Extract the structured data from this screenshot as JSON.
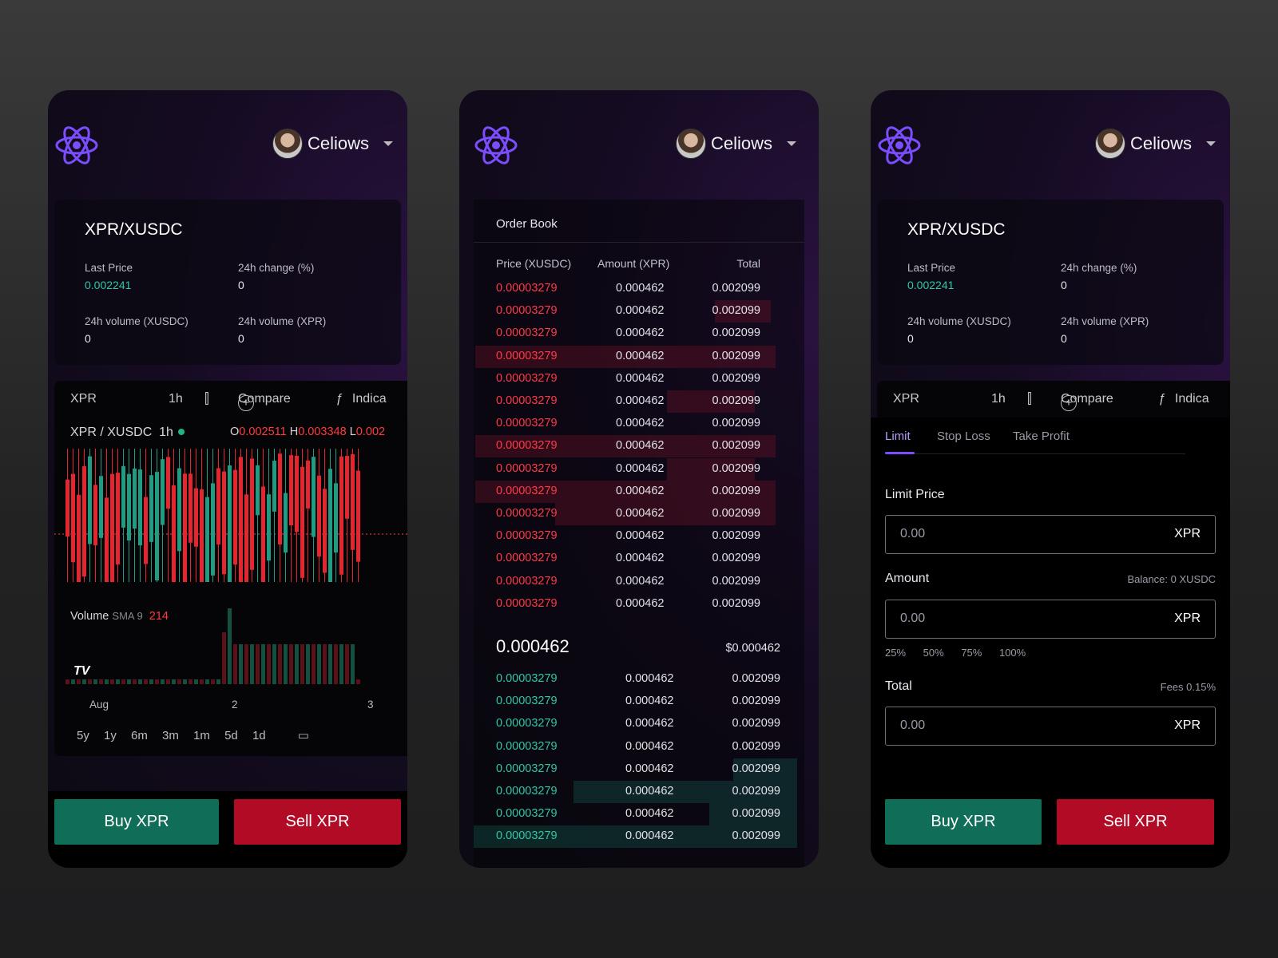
{
  "user": {
    "name": "Celiows"
  },
  "pair": "XPR/XUSDC",
  "stats": {
    "last_price_label": "Last Price",
    "last_price": "0.002241",
    "change_label": "24h change (%)",
    "change": "0",
    "vol_xusdc_label": "24h volume (XUSDC)",
    "vol_xusdc": "0",
    "vol_xpr_label": "24h volume (XPR)",
    "vol_xpr": "0"
  },
  "chart_toolbar": {
    "symbol": "XPR",
    "interval": "1h",
    "compare": "Compare",
    "indicators": "Indica"
  },
  "chart": {
    "title": "XPR / XUSDC",
    "interval": "1h",
    "ohlc_o": "0.002511",
    "ohlc_h": "0.003348",
    "ohlc_l": "0.002",
    "volume_label": "Volume",
    "sma": "SMA 9",
    "volume_value": "214",
    "axis": [
      "Aug",
      "2",
      "3"
    ],
    "ranges": [
      "5y",
      "1y",
      "6m",
      "3m",
      "1m",
      "5d",
      "1d"
    ]
  },
  "buttons": {
    "buy": "Buy XPR",
    "sell": "Sell XPR"
  },
  "orderbook": {
    "title": "Order Book",
    "headers": {
      "price": "Price (XUSDC)",
      "amount": "Amount (XPR)",
      "total": "Total"
    },
    "asks": [
      {
        "price": "0.00003279",
        "amount": "0.000462",
        "total": "0.002099"
      },
      {
        "price": "0.00003279",
        "amount": "0.000462",
        "total": "0.002099"
      },
      {
        "price": "0.00003279",
        "amount": "0.000462",
        "total": "0.002099"
      },
      {
        "price": "0.00003279",
        "amount": "0.000462",
        "total": "0.002099"
      },
      {
        "price": "0.00003279",
        "amount": "0.000462",
        "total": "0.002099"
      },
      {
        "price": "0.00003279",
        "amount": "0.000462",
        "total": "0.002099"
      },
      {
        "price": "0.00003279",
        "amount": "0.000462",
        "total": "0.002099"
      },
      {
        "price": "0.00003279",
        "amount": "0.000462",
        "total": "0.002099"
      },
      {
        "price": "0.00003279",
        "amount": "0.000462",
        "total": "0.002099"
      },
      {
        "price": "0.00003279",
        "amount": "0.000462",
        "total": "0.002099"
      },
      {
        "price": "0.00003279",
        "amount": "0.000462",
        "total": "0.002099"
      },
      {
        "price": "0.00003279",
        "amount": "0.000462",
        "total": "0.002099"
      },
      {
        "price": "0.00003279",
        "amount": "0.000462",
        "total": "0.002099"
      },
      {
        "price": "0.00003279",
        "amount": "0.000462",
        "total": "0.002099"
      },
      {
        "price": "0.00003279",
        "amount": "0.000462",
        "total": "0.002099"
      }
    ],
    "mid_price": "0.000462",
    "mid_usd": "$0.000462",
    "bids": [
      {
        "price": "0.00003279",
        "amount": "0.000462",
        "total": "0.002099"
      },
      {
        "price": "0.00003279",
        "amount": "0.000462",
        "total": "0.002099"
      },
      {
        "price": "0.00003279",
        "amount": "0.000462",
        "total": "0.002099"
      },
      {
        "price": "0.00003279",
        "amount": "0.000462",
        "total": "0.002099"
      },
      {
        "price": "0.00003279",
        "amount": "0.000462",
        "total": "0.002099"
      },
      {
        "price": "0.00003279",
        "amount": "0.000462",
        "total": "0.002099"
      },
      {
        "price": "0.00003279",
        "amount": "0.000462",
        "total": "0.002099"
      },
      {
        "price": "0.00003279",
        "amount": "0.000462",
        "total": "0.002099"
      }
    ]
  },
  "order_form": {
    "tabs": [
      "Limit",
      "Stop Loss",
      "Take Profit"
    ],
    "limit_price_label": "Limit Price",
    "amount_label": "Amount",
    "balance": "Balance: 0 XUSDC",
    "total_label": "Total",
    "fees": "Fees 0.15%",
    "value": "0.00",
    "unit": "XPR",
    "percents": [
      "25%",
      "50%",
      "75%",
      "100%"
    ]
  },
  "colors": {
    "buy": "#0f6d58",
    "sell": "#b10b26",
    "up": "#2fc7a6",
    "down": "#ff3a48",
    "accent": "#7d4cff"
  }
}
